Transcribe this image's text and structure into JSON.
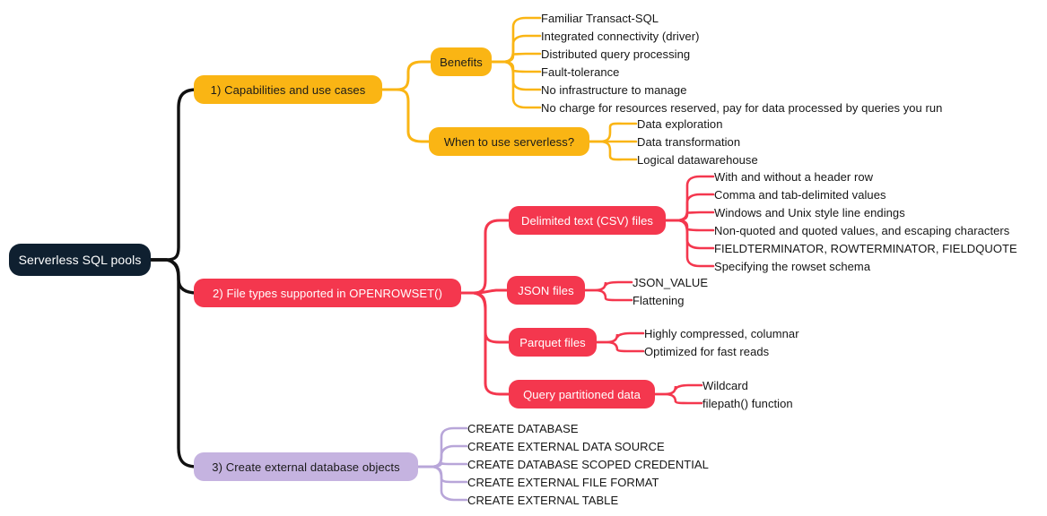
{
  "diagram": {
    "title": "Serverless SQL pools",
    "type": "mind-map",
    "background": "#ffffff",
    "colors": {
      "root_fill": "#0f2030",
      "root_text": "#ffffff",
      "branch1": "#fab514",
      "branch1_text": "#1a1a1a",
      "branch2": "#f4374e",
      "branch2_text": "#ffffff",
      "branch3": "#c5b3e0",
      "branch3_text": "#1a1a1a",
      "root_link": "#111111",
      "leaf_text": "#151515"
    }
  },
  "root": {
    "label": "Serverless SQL pools"
  },
  "branches": [
    {
      "label": "1) Capabilities and use cases",
      "color": "#fab514",
      "children": [
        {
          "label": "Benefits",
          "leaves": [
            "Familiar Transact-SQL",
            "Integrated connectivity (driver)",
            "Distributed query processing",
            "Fault-tolerance",
            "No infrastructure to manage",
            "No charge for resources reserved, pay for data processed by queries you run"
          ]
        },
        {
          "label": "When to use serverless?",
          "leaves": [
            "Data exploration",
            "Data transformation",
            "Logical datawarehouse"
          ]
        }
      ]
    },
    {
      "label": "2) File types supported in OPENROWSET()",
      "color": "#f4374e",
      "children": [
        {
          "label": "Delimited text (CSV) files",
          "leaves": [
            "With and without a header row",
            "Comma and tab-delimited values",
            "Windows and Unix style line endings",
            "Non-quoted and quoted values, and escaping characters",
            "FIELDTERMINATOR, ROWTERMINATOR, FIELDQUOTE",
            "Specifying the rowset schema"
          ]
        },
        {
          "label": "JSON files",
          "leaves": [
            "JSON_VALUE",
            "Flattening"
          ]
        },
        {
          "label": "Parquet files",
          "leaves": [
            "Highly compressed, columnar",
            "Optimized for fast reads"
          ]
        },
        {
          "label": "Query partitioned data",
          "leaves": [
            "Wildcard",
            "filepath() function"
          ]
        }
      ]
    },
    {
      "label": "3) Create external database objects",
      "color": "#c5b3e0",
      "children": [
        {
          "label": "",
          "leaves": [
            "CREATE DATABASE",
            "CREATE EXTERNAL DATA SOURCE",
            "CREATE DATABASE SCOPED CREDENTIAL",
            "CREATE EXTERNAL FILE FORMAT",
            "CREATE EXTERNAL TABLE"
          ]
        }
      ]
    }
  ]
}
